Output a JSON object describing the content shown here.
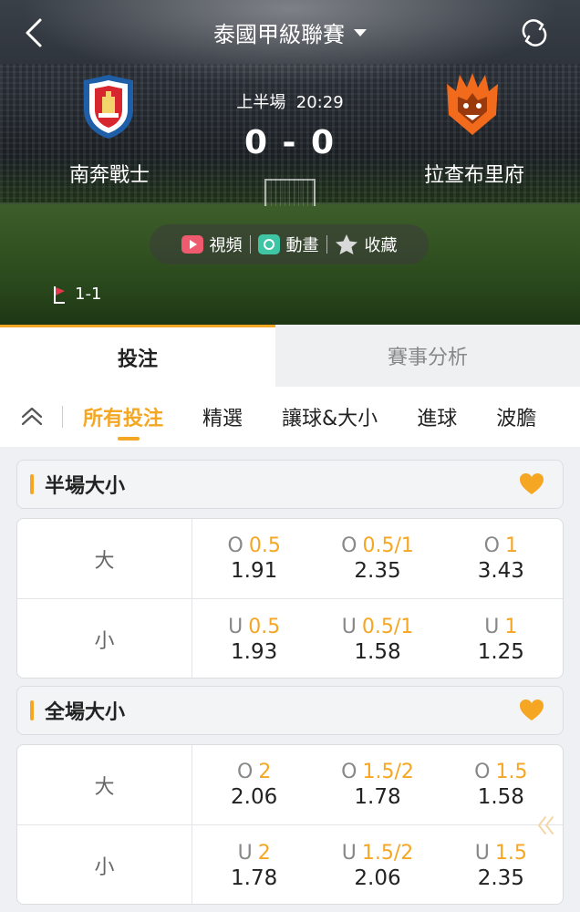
{
  "header": {
    "league": "泰國甲級聯賽",
    "period": "上半場",
    "clock": "20:29",
    "score": "0 - 0",
    "home_team": "南奔戰士",
    "away_team": "拉查布里府",
    "media": {
      "video": "視頻",
      "animation": "動畫",
      "favorite": "收藏"
    },
    "corners": "1-1"
  },
  "tabs": {
    "bet": "投注",
    "analysis": "賽事分析"
  },
  "subtabs": [
    "所有投注",
    "精選",
    "讓球&大小",
    "進球",
    "波膽"
  ],
  "markets": [
    {
      "title": "半場大小",
      "rows": [
        {
          "label": "大",
          "cells": [
            {
              "prefix": "O",
              "line": "0.5",
              "price": "1.91"
            },
            {
              "prefix": "O",
              "line": "0.5/1",
              "price": "2.35"
            },
            {
              "prefix": "O",
              "line": "1",
              "price": "3.43"
            }
          ]
        },
        {
          "label": "小",
          "cells": [
            {
              "prefix": "U",
              "line": "0.5",
              "price": "1.93"
            },
            {
              "prefix": "U",
              "line": "0.5/1",
              "price": "1.58"
            },
            {
              "prefix": "U",
              "line": "1",
              "price": "1.25"
            }
          ]
        }
      ]
    },
    {
      "title": "全場大小",
      "rows": [
        {
          "label": "大",
          "cells": [
            {
              "prefix": "O",
              "line": "2",
              "price": "2.06"
            },
            {
              "prefix": "O",
              "line": "1.5/2",
              "price": "1.78"
            },
            {
              "prefix": "O",
              "line": "1.5",
              "price": "1.58"
            }
          ]
        },
        {
          "label": "小",
          "cells": [
            {
              "prefix": "U",
              "line": "2",
              "price": "1.78"
            },
            {
              "prefix": "U",
              "line": "1.5/2",
              "price": "2.06"
            },
            {
              "prefix": "U",
              "line": "1.5",
              "price": "2.35"
            }
          ]
        }
      ]
    }
  ],
  "colors": {
    "accent": "#f5a623",
    "text": "#222222",
    "muted": "#888888"
  }
}
